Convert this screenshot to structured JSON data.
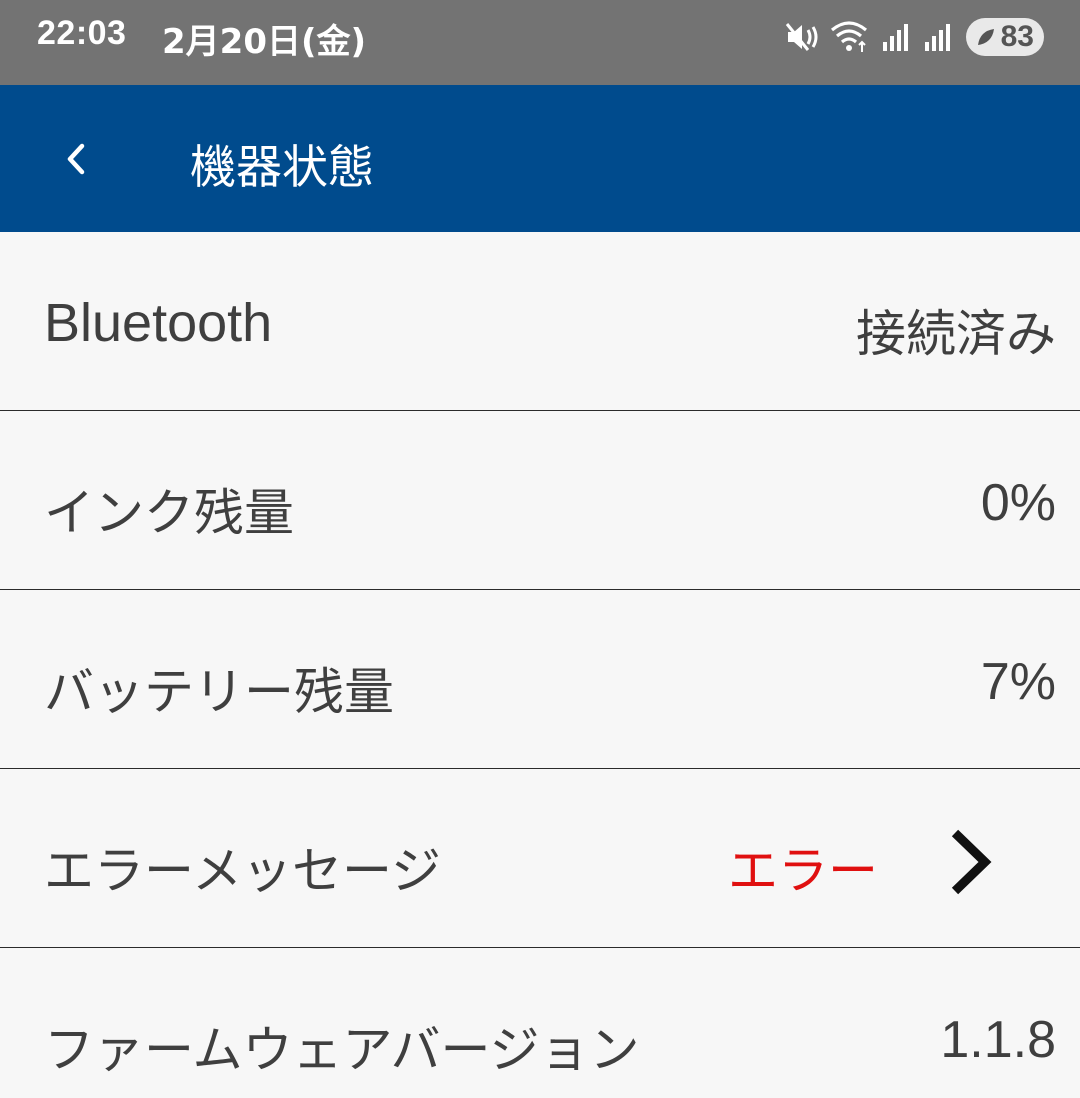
{
  "status_bar": {
    "time": "22:03",
    "date": "2月20日(金)",
    "battery_level": "83",
    "icons": [
      "mute-vibrate-icon",
      "wifi-icon",
      "signal-icon",
      "signal-icon",
      "battery-saver-icon"
    ]
  },
  "header": {
    "title": "機器状態",
    "back_icon": "chevron-left-icon",
    "background_color": "#004b8d"
  },
  "rows": [
    {
      "label": "Bluetooth",
      "value": "接続済み"
    },
    {
      "label": "インク残量",
      "value": "0%"
    },
    {
      "label": "バッテリー残量",
      "value": "7%"
    },
    {
      "label": "エラーメッセージ",
      "value": "エラー",
      "value_color": "#e01010",
      "action_icon": "chevron-right-icon"
    },
    {
      "label": "ファームウェアバージョン",
      "value": "1.1.8"
    }
  ]
}
